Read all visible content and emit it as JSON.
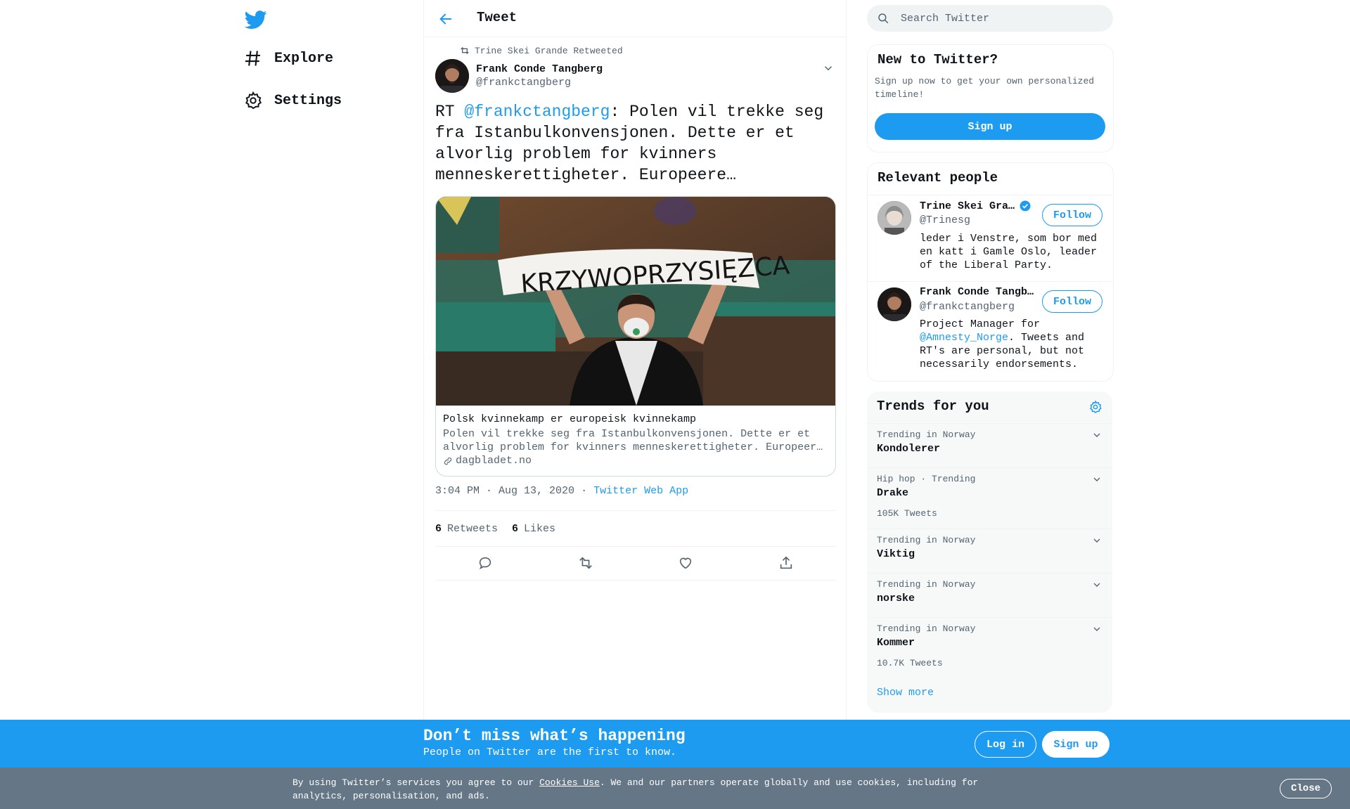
{
  "nav": {
    "logo_icon": "twitter-bird-icon",
    "items": [
      {
        "label": "Explore",
        "icon": "hashtag-icon"
      },
      {
        "label": "Settings",
        "icon": "gear-icon"
      }
    ]
  },
  "header": {
    "title": "Tweet",
    "back_icon": "back-arrow-icon"
  },
  "tweet": {
    "retweeted_by": "Trine Skei Grande Retweeted",
    "author_name": "Frank Conde Tangberg",
    "author_handle": "@frankctangberg",
    "text_prefix": "RT ",
    "mention": "@frankctangberg",
    "text_rest": ": Polen vil trekke seg fra Istanbulkonvensjonen. Dette er et alvorlig problem for kvinners menneskerettigheter. Europeere…",
    "card": {
      "image_banner_text": "KRZYWOPRZYSIĘZCA",
      "title": "Polsk kvinnekamp er europeisk kvinnekamp",
      "description_line1": "Polen vil trekke seg fra Istanbulkonvensjonen. Dette er et",
      "description_line2": "alvorlig problem for kvinners menneskerettigheter. Europeer…",
      "domain": "dagbladet.no"
    },
    "time": "3:04 PM · Aug 13, 2020",
    "separator": "·",
    "source_app": "Twitter Web App",
    "retweets_count": "6",
    "retweets_label": "Retweets",
    "likes_count": "6",
    "likes_label": "Likes"
  },
  "search": {
    "placeholder": "Search Twitter"
  },
  "new_to_twitter": {
    "title": "New to Twitter?",
    "subtitle": "Sign up now to get your own personalized timeline!",
    "button": "Sign up"
  },
  "relevant_people": {
    "title": "Relevant people",
    "people": [
      {
        "name": "Trine Skei Gra…",
        "handle": "@Trinesg",
        "verified": true,
        "bio": "leder i Venstre, som bor med en katt i Gamle Oslo, leader of the Liberal Party.",
        "follow": "Follow"
      },
      {
        "name": "Frank Conde Tangb…",
        "handle": "@frankctangberg",
        "verified": false,
        "bio_prefix": "Project Manager for ",
        "bio_mention": "@Amnesty_Norge",
        "bio_rest": ". Tweets and RT's are personal, but not necessarily endorsements.",
        "follow": "Follow"
      }
    ]
  },
  "trends": {
    "title": "Trends for you",
    "items": [
      {
        "meta": "Trending in Norway",
        "name": "Kondolerer",
        "count": ""
      },
      {
        "meta": "Hip hop · Trending",
        "name": "Drake",
        "count": "105K Tweets"
      },
      {
        "meta": "Trending in Norway",
        "name": "Viktig",
        "count": ""
      },
      {
        "meta": "Trending in Norway",
        "name": "norske",
        "count": ""
      },
      {
        "meta": "Trending in Norway",
        "name": "Kommer",
        "count": "10.7K Tweets"
      }
    ],
    "show_more": "Show more"
  },
  "promo": {
    "title": "Don’t miss what’s happening",
    "subtitle": "People on Twitter are the first to know.",
    "login": "Log in",
    "signup": "Sign up"
  },
  "cookie": {
    "text_before": "By using Twitter’s services you agree to our ",
    "link": "Cookies Use",
    "text_after": ". We and our partners operate globally and use cookies, including for analytics, personalisation, and ads.",
    "close": "Close"
  },
  "colors": {
    "accent": "#1d9bf0",
    "cookie_bg": "#657786",
    "text": "#0f1419",
    "muted": "#536471"
  }
}
